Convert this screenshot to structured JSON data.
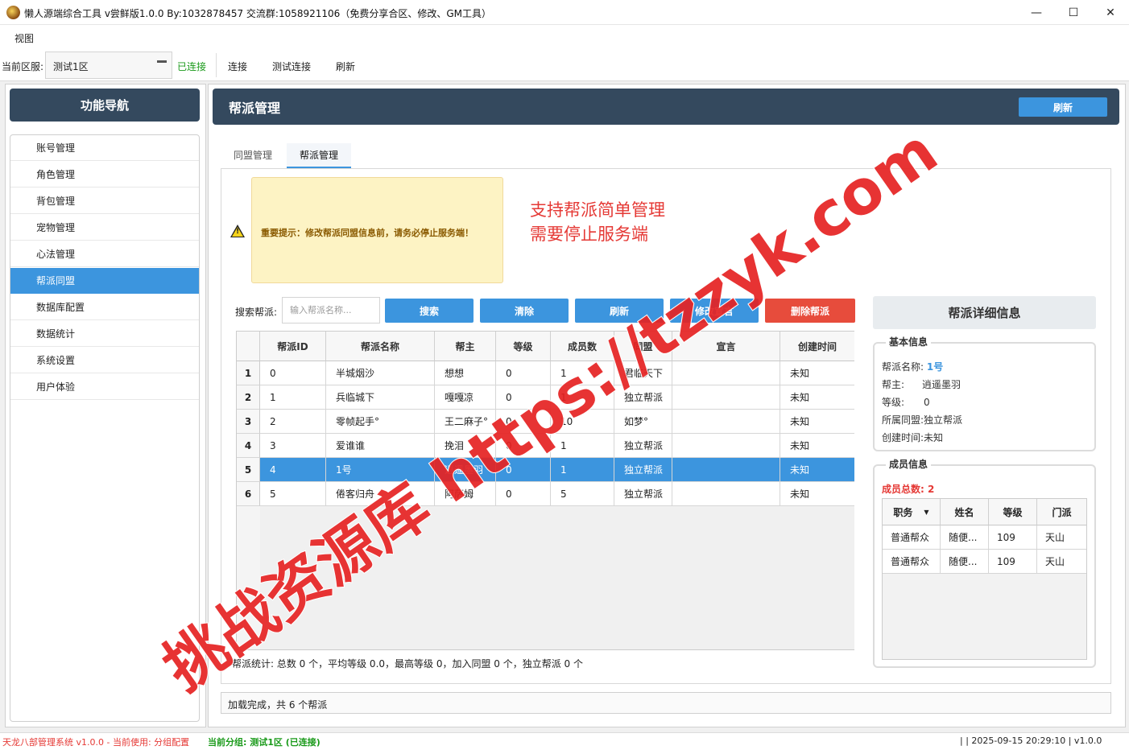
{
  "window": {
    "title": "懒人源端综合工具 v尝鲜版1.0.0 By:1032878457 交流群:1058921106（免费分享合区、修改、GM工具）",
    "minimize": "—",
    "maximize": "☐",
    "close": "✕"
  },
  "menu": {
    "view": "视图"
  },
  "toolbar": {
    "server_label": "当前区服:",
    "server_value": "测试1区",
    "status": "已连接",
    "connect": "连接",
    "test_connect": "测试连接",
    "refresh": "刷新"
  },
  "nav": {
    "header": "功能导航",
    "items": [
      "账号管理",
      "角色管理",
      "背包管理",
      "宠物管理",
      "心法管理",
      "帮派同盟",
      "数据库配置",
      "数据统计",
      "系统设置",
      "用户体验"
    ],
    "active_index": 5
  },
  "main": {
    "title": "帮派管理",
    "refresh": "刷新"
  },
  "tabs": [
    "同盟管理",
    "帮派管理"
  ],
  "warning": {
    "text": "重要提示：修改帮派同盟信息前，请务必停止服务端！",
    "icon_mark": "!"
  },
  "annotation": {
    "line1": "支持帮派简单管理",
    "line2": "需要停止服务端"
  },
  "search": {
    "label": "搜索帮派:",
    "placeholder": "输入帮派名称..."
  },
  "buttons": {
    "search": "搜索",
    "clear": "清除",
    "refresh": "刷新",
    "modify": "修改宣言",
    "delete": "删除帮派"
  },
  "grid": {
    "columns": [
      "帮派ID",
      "帮派名称",
      "帮主",
      "等级",
      "成员数",
      "同盟",
      "宣言",
      "创建时间"
    ],
    "rows": [
      {
        "n": "1",
        "id": "0",
        "name": "半城烟沙",
        "leader": "想想",
        "level": "0",
        "members": "1",
        "alliance": "君临天下",
        "decl": "",
        "created": "未知"
      },
      {
        "n": "2",
        "id": "1",
        "name": "兵临城下",
        "leader": "嘎嘎凉",
        "level": "0",
        "members": "1",
        "alliance": "独立帮派",
        "decl": "",
        "created": "未知"
      },
      {
        "n": "3",
        "id": "2",
        "name": "零帧起手°",
        "leader": "王二麻子°",
        "level": "0",
        "members": "10",
        "alliance": "如梦°",
        "decl": "",
        "created": "未知"
      },
      {
        "n": "4",
        "id": "3",
        "name": "爱谁谁",
        "leader": "挽泪",
        "level": "0",
        "members": "1",
        "alliance": "独立帮派",
        "decl": "",
        "created": "未知"
      },
      {
        "n": "5",
        "id": "4",
        "name": "1号",
        "leader": "逍遥墨羽",
        "level": "0",
        "members": "1",
        "alliance": "独立帮派",
        "decl": "",
        "created": "未知"
      },
      {
        "n": "6",
        "id": "5",
        "name": "倦客归舟",
        "leader": "阿萨姆",
        "level": "0",
        "members": "5",
        "alliance": "独立帮派",
        "decl": "",
        "created": "未知"
      }
    ],
    "selected_row": 4
  },
  "stats": "帮派统计: 总数 0 个，平均等级 0.0，最高等级 0，加入同盟 0 个，独立帮派 0 个",
  "detail": {
    "title": "帮派详细信息",
    "basic_title": "基本信息",
    "name_label": "帮派名称:",
    "name_value": "1号",
    "leader_label": "帮主:",
    "leader_value": "逍遥墨羽",
    "level_label": "等级:",
    "level_value": "0",
    "alliance_label": "所属同盟:",
    "alliance_value": "独立帮派",
    "created_label": "创建时间:",
    "created_value": "未知",
    "member_title": "成员信息",
    "member_total": "成员总数: 2",
    "member_columns": [
      "职务",
      "姓名",
      "等级",
      "门派"
    ],
    "members": [
      {
        "role": "普通帮众",
        "name": "随便...",
        "level": "109",
        "school": "天山"
      },
      {
        "role": "普通帮众",
        "name": "随便...",
        "level": "109",
        "school": "天山"
      }
    ]
  },
  "status_box": "加载完成，共 6 个帮派",
  "statusbar": {
    "left_red": "天龙八部管理系统 v1.0.0 - 当前使用: 分组配置",
    "left_green": "当前分组: 测试1区 (已连接)",
    "right": "| | 2025-09-15 20:29:10 | v1.0.0"
  },
  "watermark": "挑战资源库 https://tzzyk.com",
  "colors": {
    "primary": "#3c95de",
    "header_dark": "#34495e",
    "danger": "#e74c3c",
    "warning_bg": "#fdf3c4",
    "success": "#1a9a1a",
    "watermark": "#e52222"
  }
}
